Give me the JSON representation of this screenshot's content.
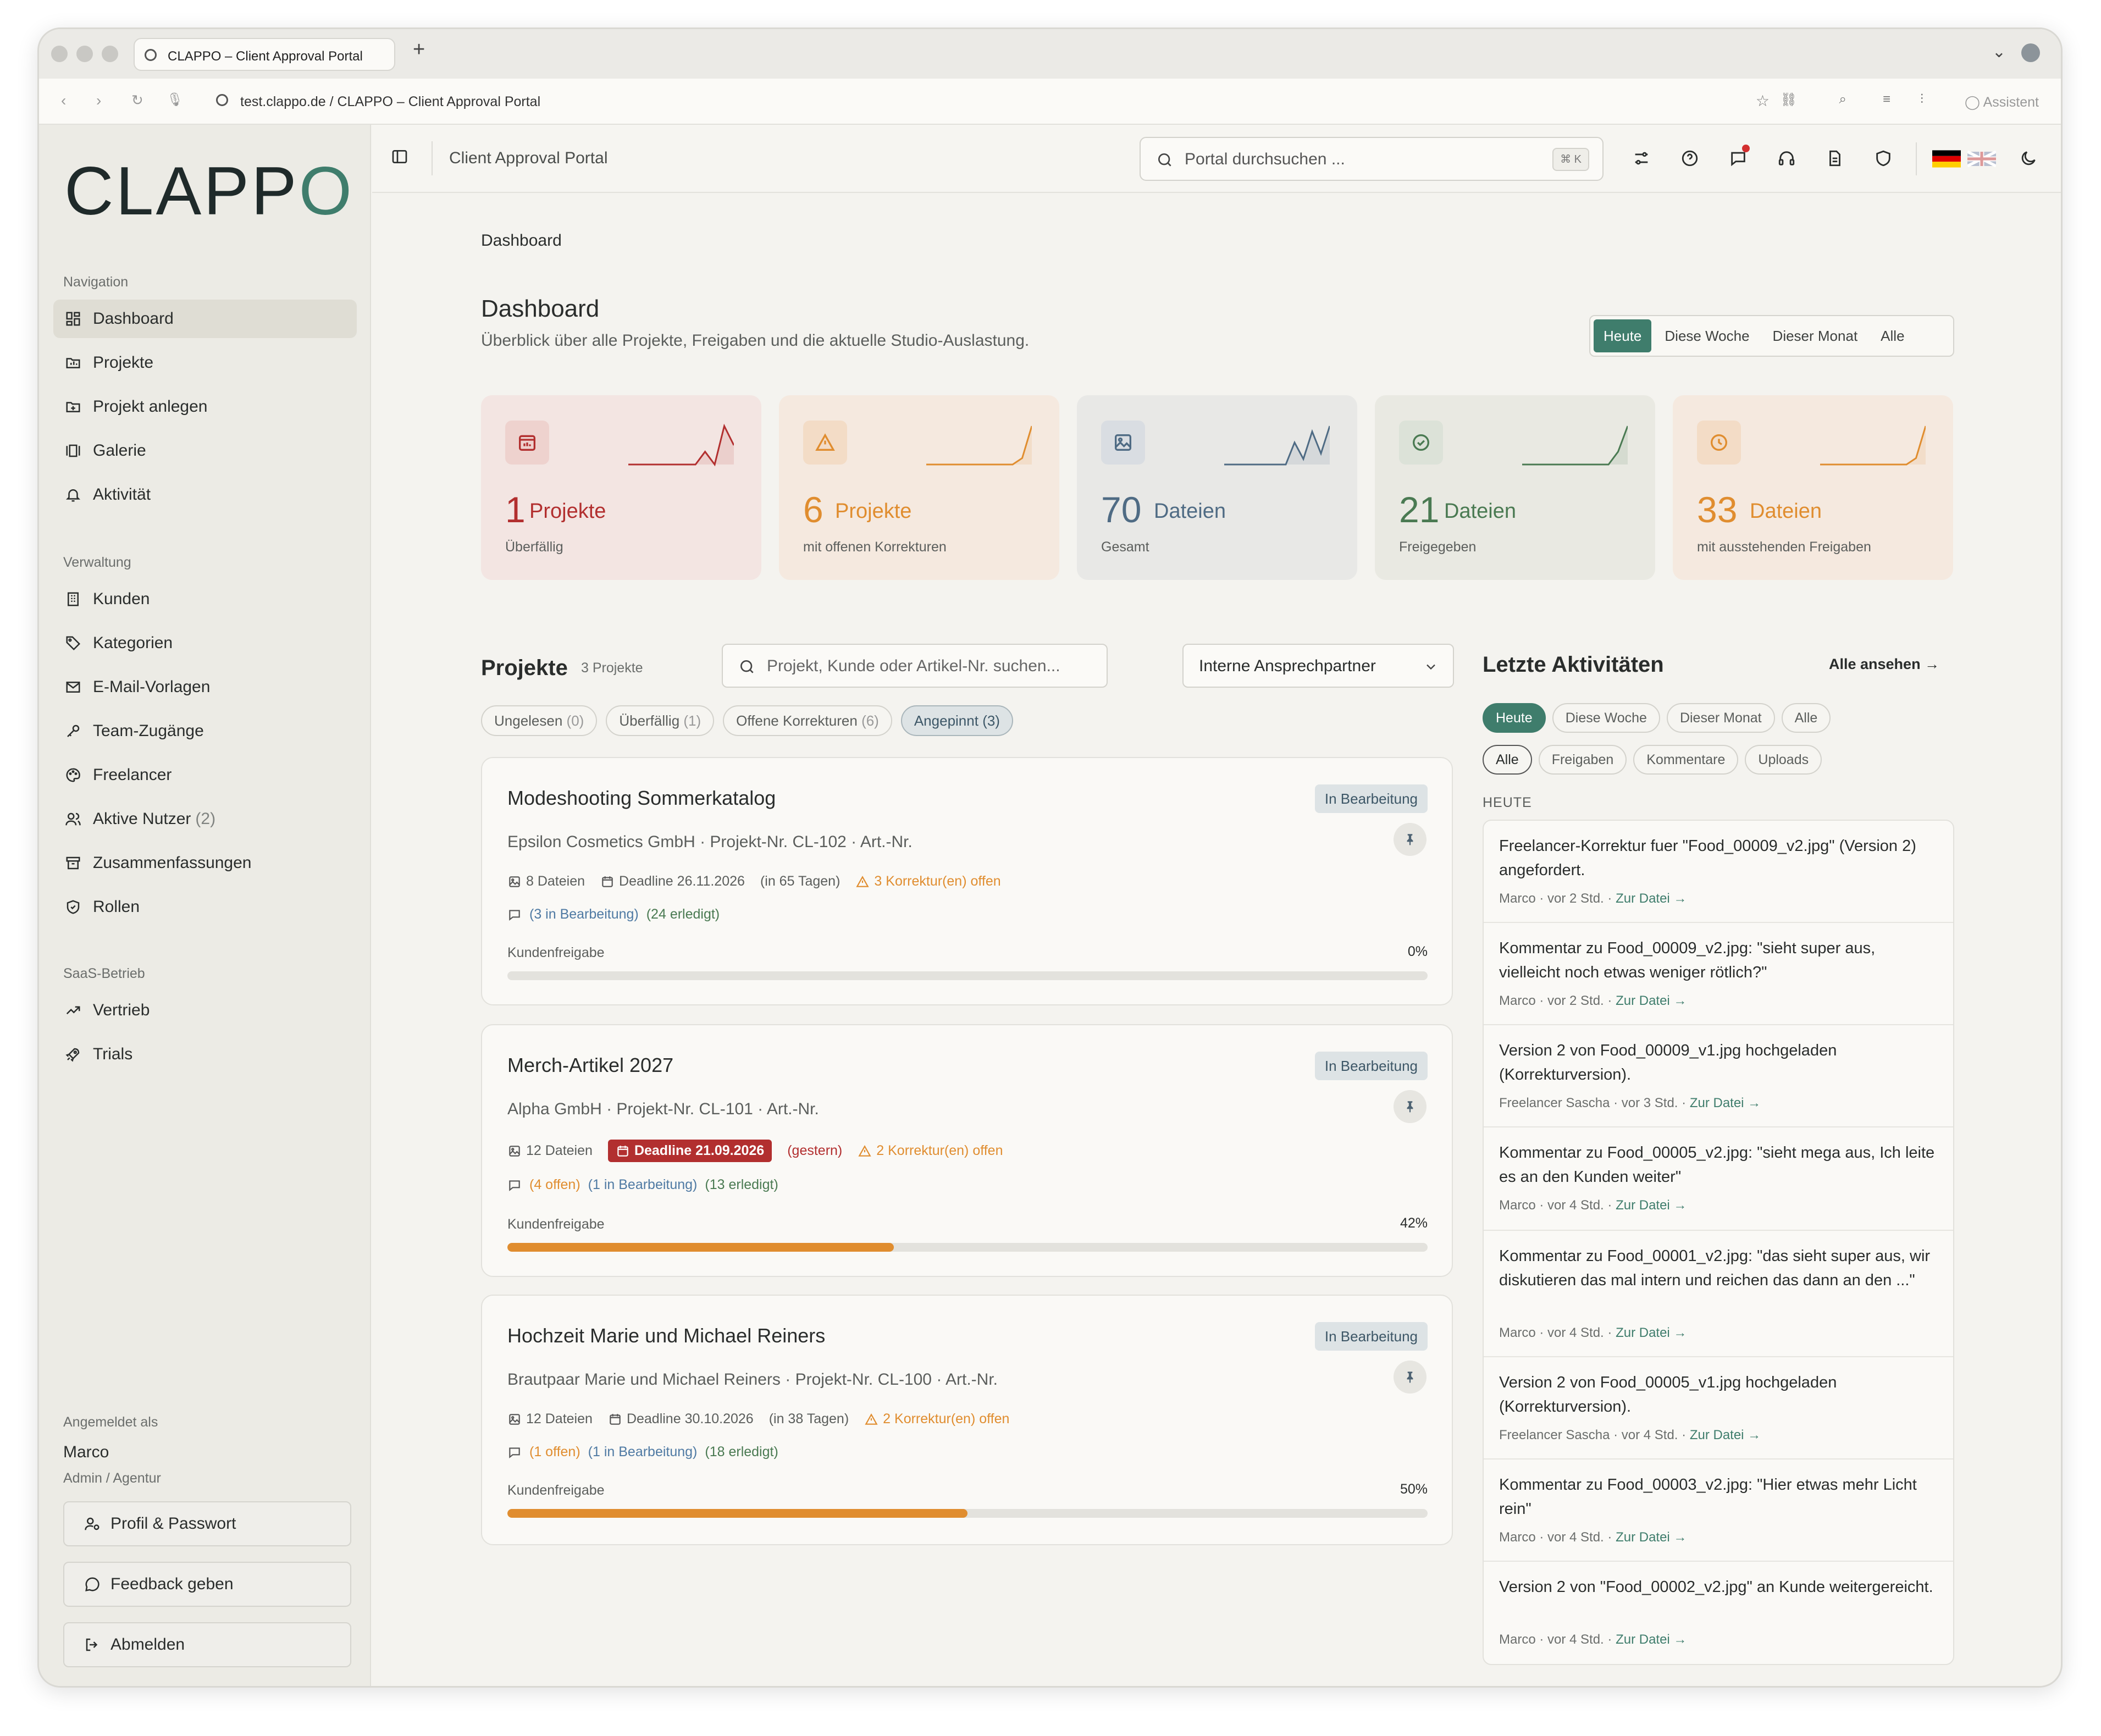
{
  "browser": {
    "tab_title": "CLAPPO – Client Approval Portal",
    "new_tab": "+",
    "url": "test.clappo.de / CLAPPO – Client Approval Portal",
    "assistant": "Assistent"
  },
  "brand": {
    "logo_left": "CLAPP",
    "logo_o": "O",
    "accent": "#3f7d6c"
  },
  "sidebar": {
    "sections": [
      {
        "label": "Navigation"
      },
      {
        "label": "Verwaltung"
      },
      {
        "label": "SaaS-Betrieb"
      }
    ],
    "items": [
      {
        "label": "Dashboard",
        "icon": "dashboard-icon"
      },
      {
        "label": "Projekte",
        "icon": "projects-icon"
      },
      {
        "label": "Projekt anlegen",
        "icon": "folder-plus-icon"
      },
      {
        "label": "Galerie",
        "icon": "gallery-icon"
      },
      {
        "label": "Aktivität",
        "icon": "bell-icon"
      },
      {
        "label": "Kunden",
        "icon": "building-icon"
      },
      {
        "label": "Kategorien",
        "icon": "tag-icon"
      },
      {
        "label": "E-Mail-Vorlagen",
        "icon": "mail-icon"
      },
      {
        "label": "Team-Zugänge",
        "icon": "key-icon"
      },
      {
        "label": "Freelancer",
        "icon": "palette-icon"
      },
      {
        "label": "Aktive Nutzer",
        "count": "(2)",
        "icon": "users-icon"
      },
      {
        "label": "Zusammenfassungen",
        "icon": "archive-icon"
      },
      {
        "label": "Rollen",
        "icon": "shield-icon"
      },
      {
        "label": "Vertrieb",
        "icon": "trend-icon"
      },
      {
        "label": "Trials",
        "icon": "rocket-icon"
      }
    ],
    "account": {
      "label": "Angemeldet als",
      "name": "Marco",
      "role": "Admin / Agentur",
      "profile": "Profil & Passwort",
      "feedback": "Feedback geben",
      "logout": "Abmelden"
    }
  },
  "topbar": {
    "title": "Client Approval Portal",
    "search_placeholder": "Portal durchsuchen ...",
    "shortcut": "⌘ K"
  },
  "page": {
    "breadcrumb": "Dashboard",
    "title": "Dashboard",
    "subtitle": "Überblick über alle Projekte, Freigaben und die aktuelle Studio-Auslastung.",
    "range_tabs": [
      "Heute",
      "Diese Woche",
      "Dieser Monat",
      "Alle"
    ]
  },
  "stats": [
    {
      "value": "1",
      "unit": "Projekte",
      "caption": "Überfällig",
      "color": "#b22f2f",
      "trend": [
        0,
        0,
        0,
        0,
        0,
        0,
        0,
        0,
        2,
        0,
        6,
        3
      ]
    },
    {
      "value": "6",
      "unit": "Projekte",
      "caption": "mit offenen Korrekturen",
      "color": "#e08d2f",
      "trend": [
        0,
        0,
        0,
        0,
        0,
        0,
        0,
        0,
        0,
        0,
        1,
        6
      ]
    },
    {
      "value": "70",
      "unit": "Dateien",
      "caption": "Gesamt",
      "color": "#4f6b84",
      "trend": [
        0,
        0,
        0,
        0,
        0,
        0,
        0,
        0,
        4,
        1,
        6,
        2,
        7
      ]
    },
    {
      "value": "21",
      "unit": "Dateien",
      "caption": "Freigegeben",
      "color": "#4a7a52",
      "trend": [
        0,
        0,
        0,
        0,
        0,
        0,
        0,
        0,
        0,
        0,
        2,
        6
      ]
    },
    {
      "value": "33",
      "unit": "Dateien",
      "caption": "mit ausstehenden Freigaben",
      "color": "#e08d2f",
      "trend": [
        0,
        0,
        0,
        0,
        0,
        0,
        0,
        0,
        0,
        0,
        1,
        6
      ]
    }
  ],
  "projects": {
    "title": "Projekte",
    "count": "3 Projekte",
    "search_placeholder": "Projekt, Kunde oder Artikel-Nr. suchen...",
    "contact_select": "Interne Ansprechpartner",
    "filters": [
      {
        "label": "Ungelesen",
        "count": "(0)"
      },
      {
        "label": "Überfällig",
        "count": "(1)"
      },
      {
        "label": "Offene Korrekturen",
        "count": "(6)"
      },
      {
        "label": "Angepinnt",
        "count": "(3)"
      }
    ],
    "list": [
      {
        "title": "Modeshooting Sommerkatalog",
        "status": "In Bearbeitung",
        "client": "Epsilon Cosmetics GmbH · Projekt-Nr. CL-102 · Art.-Nr.",
        "files": "8 Dateien",
        "deadline": "Deadline 26.11.2026",
        "deadline_rel": "(in 65 Tagen)",
        "corrections": "3 Korrektur(en) offen",
        "comments": [
          {
            "text": "(3 in Bearbeitung)",
            "tone": "blue"
          },
          {
            "text": "(24 erledigt)",
            "tone": "green"
          }
        ],
        "approval_label": "Kundenfreigabe",
        "approval_pct": "0%",
        "approval": 0
      },
      {
        "title": "Merch-Artikel 2027",
        "status": "In Bearbeitung",
        "client": "Alpha GmbH · Projekt-Nr. CL-101 · Art.-Nr.",
        "files": "12 Dateien",
        "deadline": "Deadline 21.09.2026",
        "deadline_rel": "(gestern)",
        "overdue": true,
        "corrections": "2 Korrektur(en) offen",
        "comments": [
          {
            "text": "(4 offen)",
            "tone": "orange"
          },
          {
            "text": "(1 in Bearbeitung)",
            "tone": "blue"
          },
          {
            "text": "(13 erledigt)",
            "tone": "green"
          }
        ],
        "approval_label": "Kundenfreigabe",
        "approval_pct": "42%",
        "approval": 42
      },
      {
        "title": "Hochzeit Marie und Michael Reiners",
        "status": "In Bearbeitung",
        "client": "Brautpaar Marie und Michael Reiners · Projekt-Nr. CL-100 · Art.-Nr.",
        "files": "12 Dateien",
        "deadline": "Deadline 30.10.2026",
        "deadline_rel": "(in 38 Tagen)",
        "corrections": "2 Korrektur(en) offen",
        "comments": [
          {
            "text": "(1 offen)",
            "tone": "orange"
          },
          {
            "text": "(1 in Bearbeitung)",
            "tone": "blue"
          },
          {
            "text": "(18 erledigt)",
            "tone": "green"
          }
        ],
        "approval_label": "Kundenfreigabe",
        "approval_pct": "50%",
        "approval": 50
      }
    ]
  },
  "activity": {
    "title": "Letzte Aktivitäten",
    "see_all": "Alle ansehen",
    "time_filters": [
      "Heute",
      "Diese Woche",
      "Dieser Monat",
      "Alle"
    ],
    "type_filters": [
      "Alle",
      "Freigaben",
      "Kommentare",
      "Uploads"
    ],
    "group": "HEUTE",
    "link": "Zur Datei →",
    "items": [
      {
        "text": "Freelancer-Korrektur fuer \"Food_00009_v2.jpg\" (Version 2) angefordert.",
        "meta": "Marco · vor 2 Std. · "
      },
      {
        "text": "Kommentar zu Food_00009_v2.jpg: \"sieht super aus, vielleicht noch etwas weniger rötlich?\"",
        "meta": "Marco · vor 2 Std. · "
      },
      {
        "text": "Version 2 von Food_00009_v1.jpg hochgeladen (Korrekturversion).",
        "meta": "Freelancer Sascha · vor 3 Std. · "
      },
      {
        "text": "Kommentar zu Food_00005_v2.jpg: \"sieht mega aus, Ich leite es an den Kunden weiter\"",
        "meta": "Marco · vor 4 Std. · "
      },
      {
        "text": "Kommentar zu Food_00001_v2.jpg: \"das sieht super aus, wir diskutieren das mal intern und reichen das dann an den ...\"",
        "meta": "Marco · vor 4 Std. · "
      },
      {
        "text": "Version 2 von Food_00005_v1.jpg hochgeladen (Korrekturversion).",
        "meta": "Freelancer Sascha · vor 4 Std. · "
      },
      {
        "text": "Kommentar zu Food_00003_v2.jpg: \"Hier etwas mehr Licht rein\"",
        "meta": "Marco · vor 4 Std. · "
      },
      {
        "text": "Version 2 von \"Food_00002_v2.jpg\" an Kunde weitergereicht.",
        "meta": "Marco · vor 4 Std. · "
      }
    ]
  }
}
